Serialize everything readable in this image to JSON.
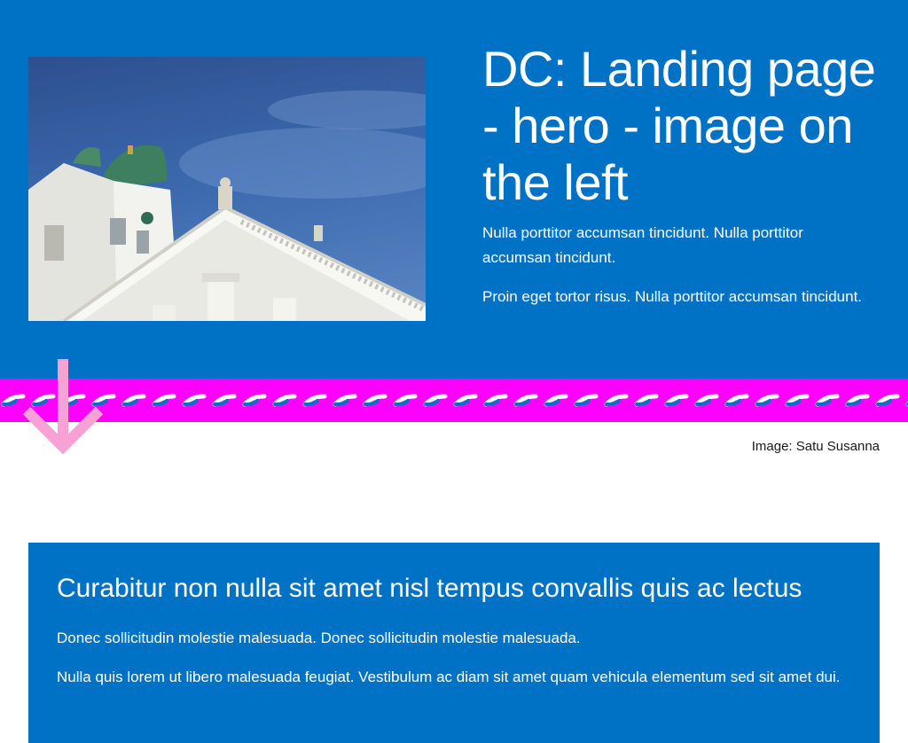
{
  "hero": {
    "title": "DC: Landing page - hero - image on the left",
    "paragraphs": [
      "Nulla porttitor accumsan tincidunt. Nulla porttitor accumsan tincidunt.",
      "Proin eget tortor risus. Nulla porttitor accumsan tincidunt."
    ],
    "image_caption": "Image: Satu Susanna"
  },
  "content_card": {
    "title": "Curabitur non nulla sit amet nisl tempus convallis quis ac lectus",
    "paragraphs": [
      "Donec sollicitudin molestie malesuada. Donec sollicitudin molestie malesuada.",
      "Nulla quis lorem ut libero malesuada feugiat. Vestibulum ac diam sit amet quam vehicula elementum sed sit amet dui."
    ]
  },
  "colors": {
    "hero_background": "#0072c6",
    "koro_band": "#ff00ff",
    "arrow": "#f7a1d4",
    "card_background": "#0072c6"
  },
  "icons": {
    "arrow": "arrow-down-icon"
  }
}
